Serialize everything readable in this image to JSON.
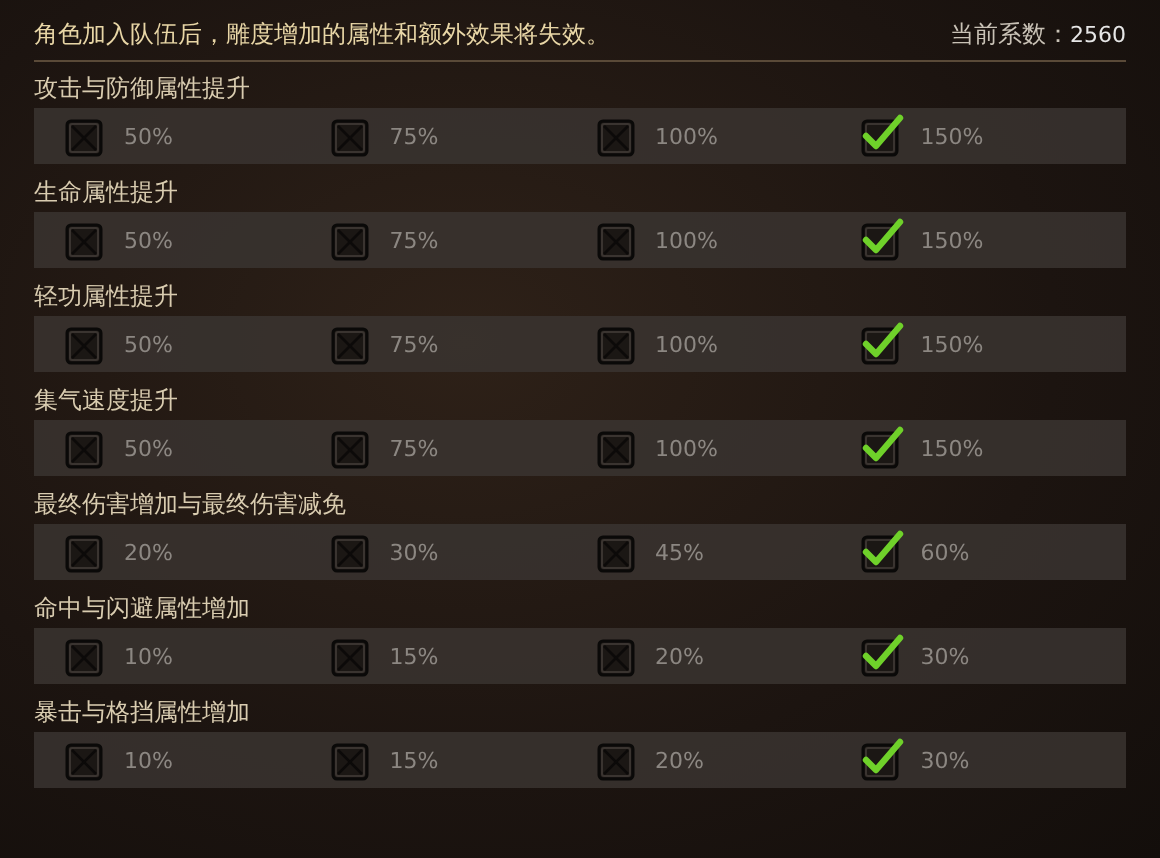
{
  "header": {
    "notice": "角色加入队伍后，雕度增加的属性和额外效果将失效。",
    "coefficient_label": "当前系数：",
    "coefficient_value": "2560"
  },
  "groups": [
    {
      "title": "攻击与防御属性提升",
      "options": [
        {
          "label": "50%",
          "checked": false
        },
        {
          "label": "75%",
          "checked": false
        },
        {
          "label": "100%",
          "checked": false
        },
        {
          "label": "150%",
          "checked": true
        }
      ]
    },
    {
      "title": "生命属性提升",
      "options": [
        {
          "label": "50%",
          "checked": false
        },
        {
          "label": "75%",
          "checked": false
        },
        {
          "label": "100%",
          "checked": false
        },
        {
          "label": "150%",
          "checked": true
        }
      ]
    },
    {
      "title": "轻功属性提升",
      "options": [
        {
          "label": "50%",
          "checked": false
        },
        {
          "label": "75%",
          "checked": false
        },
        {
          "label": "100%",
          "checked": false
        },
        {
          "label": "150%",
          "checked": true
        }
      ]
    },
    {
      "title": "集气速度提升",
      "options": [
        {
          "label": "50%",
          "checked": false
        },
        {
          "label": "75%",
          "checked": false
        },
        {
          "label": "100%",
          "checked": false
        },
        {
          "label": "150%",
          "checked": true
        }
      ]
    },
    {
      "title": "最终伤害增加与最终伤害减免",
      "options": [
        {
          "label": "20%",
          "checked": false
        },
        {
          "label": "30%",
          "checked": false
        },
        {
          "label": "45%",
          "checked": false
        },
        {
          "label": "60%",
          "checked": true
        }
      ]
    },
    {
      "title": "命中与闪避属性增加",
      "options": [
        {
          "label": "10%",
          "checked": false
        },
        {
          "label": "15%",
          "checked": false
        },
        {
          "label": "20%",
          "checked": false
        },
        {
          "label": "30%",
          "checked": true
        }
      ]
    },
    {
      "title": "暴击与格挡属性增加",
      "options": [
        {
          "label": "10%",
          "checked": false
        },
        {
          "label": "15%",
          "checked": false
        },
        {
          "label": "20%",
          "checked": false
        },
        {
          "label": "30%",
          "checked": true
        }
      ]
    }
  ]
}
